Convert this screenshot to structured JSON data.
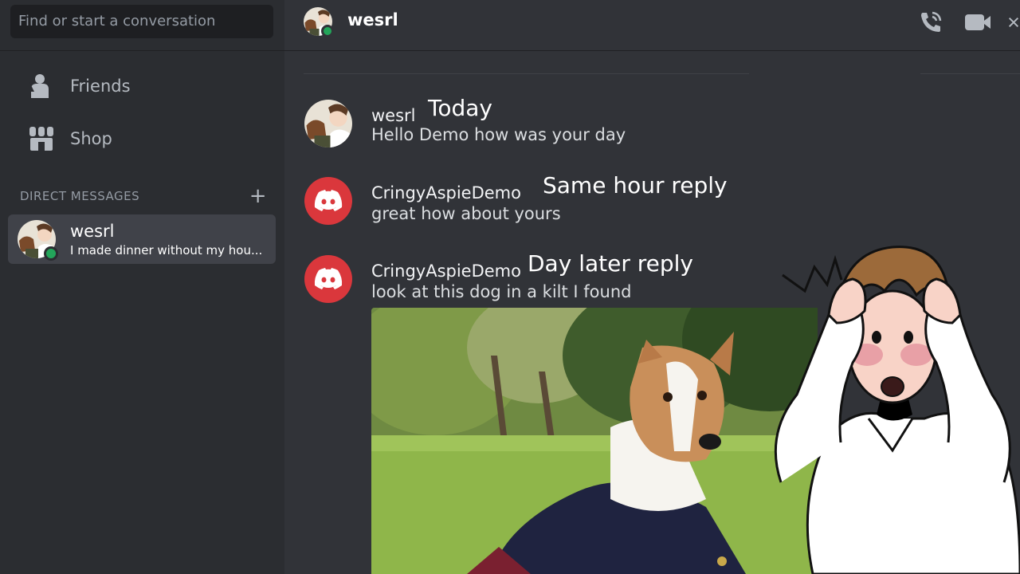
{
  "search": {
    "placeholder": "Find or start a conversation"
  },
  "sidebar": {
    "nav": [
      {
        "label": "Friends",
        "icon": "friends-icon"
      },
      {
        "label": "Shop",
        "icon": "shop-icon"
      }
    ],
    "dm_header": "DIRECT MESSAGES",
    "dm_add": "+",
    "dms": [
      {
        "name": "wesrl",
        "preview": "I made dinner without my hou...",
        "status": "online"
      }
    ]
  },
  "topbar": {
    "title": "wesrl",
    "icons": [
      "phone-call-icon",
      "video-call-icon",
      "close-icon"
    ]
  },
  "messages": [
    {
      "author": "wesrl",
      "annotation": "Today",
      "text": "Hello Demo how was your day",
      "avatar": "user-avatar"
    },
    {
      "author": "CringyAspieDemo",
      "annotation": "Same hour reply",
      "text": "great how about yours",
      "avatar": "discord-logo"
    },
    {
      "author": "CringyAspieDemo",
      "annotation": "Day later reply",
      "text": "look at this dog in a kilt I found",
      "avatar": "discord-logo",
      "attachment": "dog-in-kilt-photo"
    }
  ],
  "colors": {
    "bg": "#313338",
    "sidebar": "#2b2d31",
    "selected": "#404249",
    "online": "#23a55a",
    "discord_red": "#da373c"
  }
}
